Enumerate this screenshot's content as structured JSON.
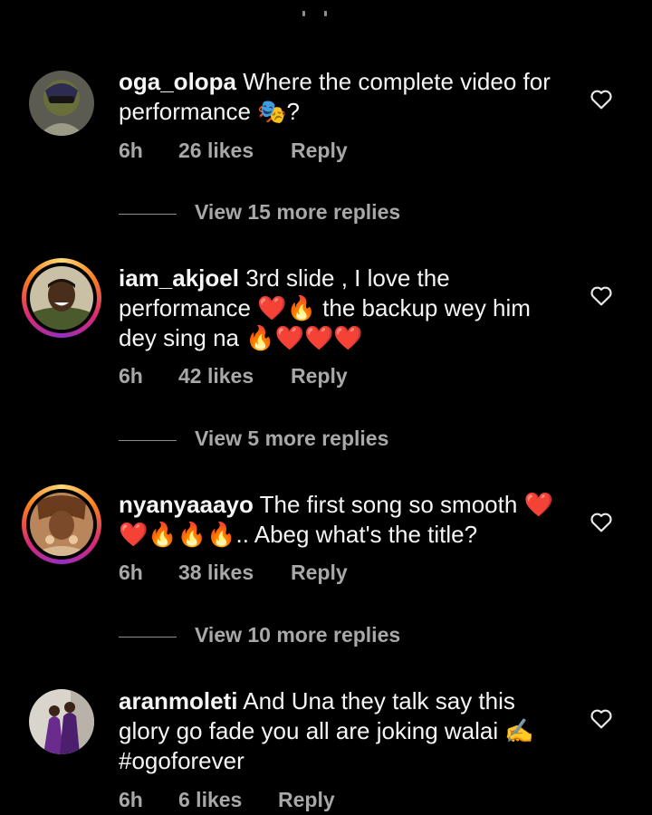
{
  "comments": [
    {
      "username": "oga_olopa",
      "text": "Where the complete video for performance 🎭?",
      "time": "6h",
      "likes": "26 likes",
      "reply": "Reply",
      "view_more": "View 15 more replies"
    },
    {
      "username": "iam_akjoel",
      "text": "3rd slide , I love the performance ❤️🔥 the backup wey him dey sing na 🔥❤️❤️❤️",
      "time": "6h",
      "likes": "42 likes",
      "reply": "Reply",
      "view_more": "View 5 more replies"
    },
    {
      "username": "nyanyaaayo",
      "text": "The first song so smooth ❤️❤️🔥🔥🔥.. Abeg what's the title?",
      "time": "6h",
      "likes": "38 likes",
      "reply": "Reply",
      "view_more": "View 10 more replies"
    },
    {
      "username": "aranmoleti",
      "text": "And Una they talk say this glory go fade you all are joking walai ✍️ #ogoforever",
      "time": "6h",
      "likes": "6 likes",
      "reply": "Reply"
    }
  ],
  "icons": {
    "like": "heart-outline-icon"
  },
  "colors": {
    "background": "#000000",
    "primary_text": "#f5f5f5",
    "secondary_text": "#a8a8a8",
    "story_ring": [
      "#feda75",
      "#fa7e1e",
      "#d62976",
      "#962fbf"
    ]
  }
}
